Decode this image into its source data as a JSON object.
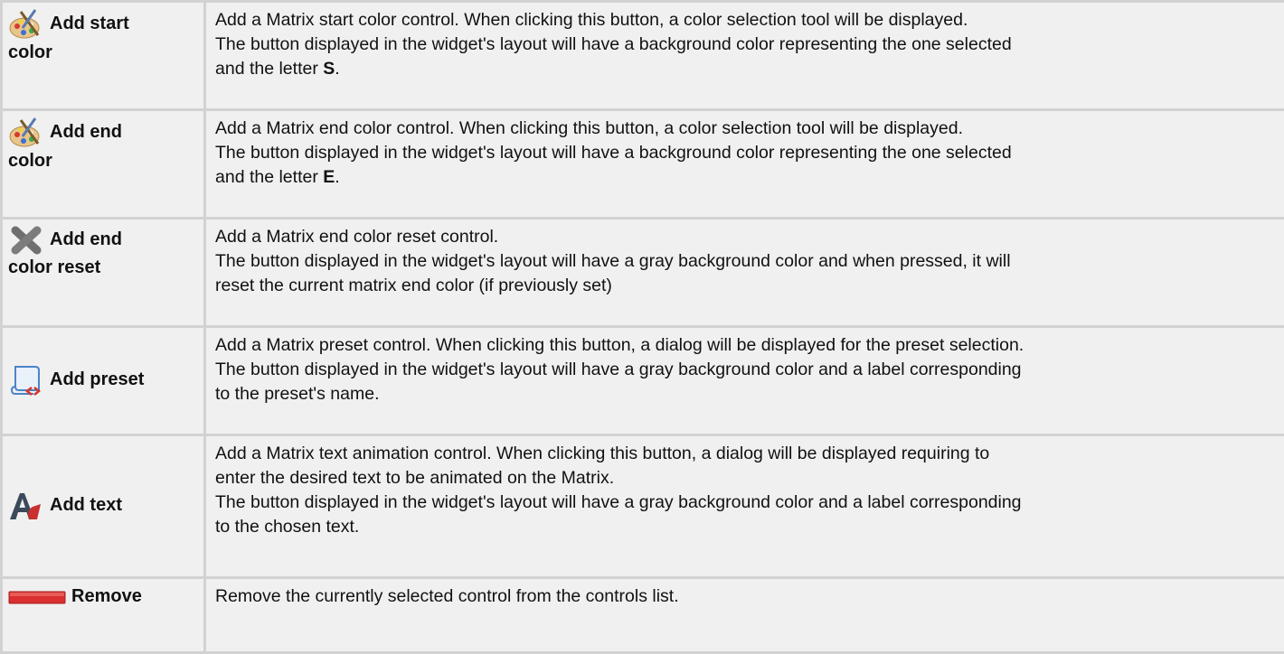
{
  "rows": [
    {
      "label": "Add start color",
      "label_line1": "Add start",
      "label_line2": "color",
      "icon": "palette-icon",
      "lines": [
        "Add a Matrix start color control. When clicking this button, a color selection tool will be displayed.",
        "The button displayed in the widget's layout will have a background color representing the one selected",
        "and the letter "
      ],
      "bold_letter": "S",
      "tail": "."
    },
    {
      "label": "Add end color",
      "label_line1": "Add end",
      "label_line2": "color",
      "icon": "palette-icon",
      "lines": [
        "Add a Matrix end color control. When clicking this button, a color selection tool will be displayed.",
        "The button displayed in the widget's layout will have a background color representing the one selected",
        "and the letter "
      ],
      "bold_letter": "E",
      "tail": "."
    },
    {
      "label": "Add end color reset",
      "label_line1": "Add end",
      "label_line2": "color reset",
      "icon": "close-x-icon",
      "lines": [
        "Add a Matrix end color reset control.",
        "The button displayed in the widget's layout will have a gray background color and when pressed, it will",
        "reset the current matrix end color (if previously set)"
      ]
    },
    {
      "label": "Add preset",
      "icon": "scroll-icon",
      "lines": [
        "Add a Matrix preset control. When clicking this button, a dialog will be displayed for the preset selection.",
        "The button displayed in the widget's layout will have a gray background color and a label corresponding",
        "to the preset's name."
      ]
    },
    {
      "label": "Add text",
      "icon": "text-font-icon",
      "lines": [
        "Add a Matrix text animation control. When clicking this button, a dialog will be displayed requiring to",
        "enter the desired text to be animated on the Matrix.",
        "The button displayed in the widget's layout will have a gray background color and a label corresponding",
        "to the chosen text."
      ]
    },
    {
      "label": "Remove",
      "icon": "red-bar-icon",
      "lines": [
        "Remove the currently selected control from the controls list."
      ]
    }
  ],
  "colors": {
    "cell_bg": "#f0f0f0",
    "border": "#d2d2d2",
    "remove_red": "#d9302f"
  }
}
